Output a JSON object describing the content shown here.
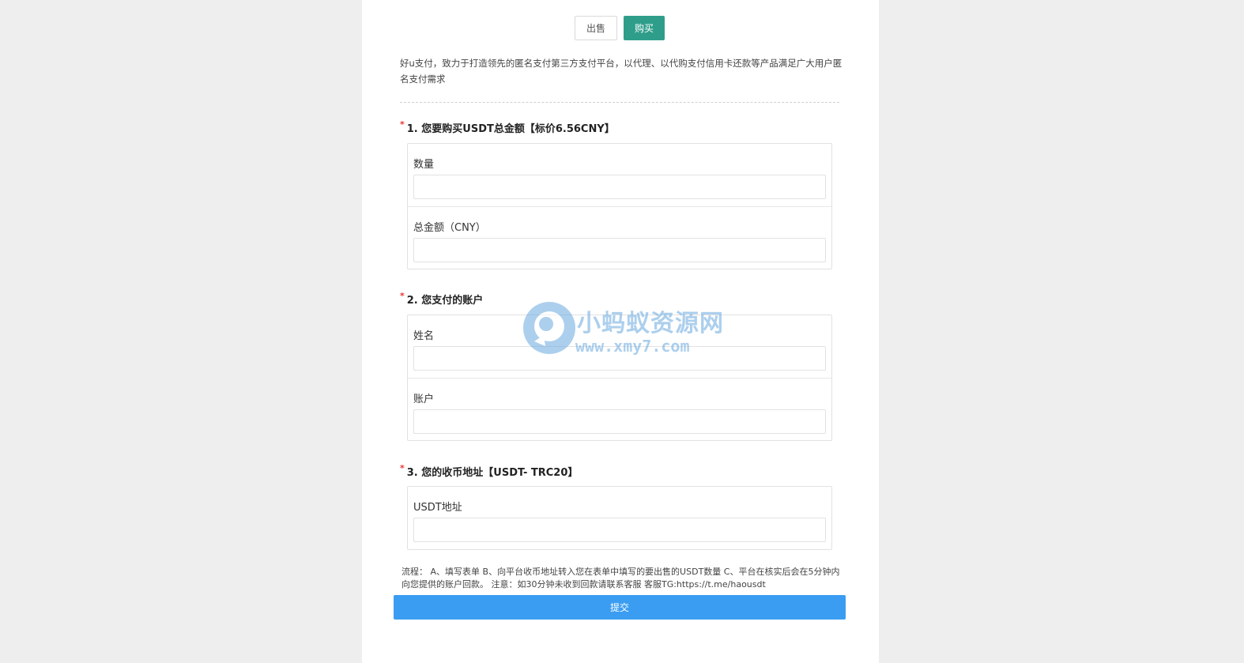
{
  "toggle": {
    "sell_label": "出售",
    "buy_label": "购买"
  },
  "intro_text": "好u支付，致力于打造领先的匿名支付第三方支付平台，以代理、以代购支付信用卡还款等产品满足广大用户匿名支付需求",
  "sections": [
    {
      "required_mark": "*",
      "title": "1. 您要购买USDT总金额【标价6.56CNY】",
      "fields": [
        {
          "label": "数量",
          "value": "",
          "placeholder": ""
        },
        {
          "label": "总金额（CNY）",
          "value": "",
          "placeholder": ""
        }
      ]
    },
    {
      "required_mark": "*",
      "title": "2. 您支付的账户",
      "fields": [
        {
          "label": "姓名",
          "value": "",
          "placeholder": ""
        },
        {
          "label": "账户",
          "value": "",
          "placeholder": ""
        }
      ]
    },
    {
      "required_mark": "*",
      "title": "3. 您的收币地址【USDT- TRC20】",
      "fields": [
        {
          "label": "USDT地址",
          "value": "",
          "placeholder": ""
        }
      ]
    }
  ],
  "process_text": "流程： A、填写表单 B、向平台收币地址转入您在表单中填写的要出售的USDT数量 C、平台在核实后会在5分钟内向您提供的账户回款。 注意：如30分钟未收到回款请联系客服 客服TG:https://t.me/haousdt",
  "submit_label": "提交",
  "watermark": {
    "name": "小蚂蚁资源网",
    "url": "www.xmy7.com"
  },
  "colors": {
    "buy_button": "#2e9e8a",
    "submit_button": "#3a9df2",
    "required_star": "#e33333",
    "page_background": "#eeeeee"
  }
}
